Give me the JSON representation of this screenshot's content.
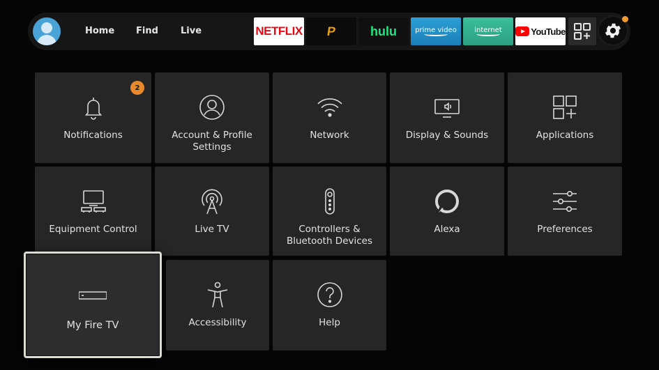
{
  "nav": {
    "home": "Home",
    "find": "Find",
    "live": "Live"
  },
  "apps": {
    "netflix": "NETFLIX",
    "plex": "P",
    "hulu": "hulu",
    "prime_video": "prime video",
    "internet": "internet",
    "youtube": "YouTube"
  },
  "icons": {
    "profile": "avatar-person-icon",
    "apps": "app-grid-icon",
    "settings": "gear-icon"
  },
  "colors": {
    "background": "#050505",
    "tile": "#262626",
    "badge": "#e88a2c",
    "focus_border": "#dcdcd4"
  },
  "settings_tiles": [
    {
      "label": "Notifications",
      "icon": "bell-icon",
      "badge": "2"
    },
    {
      "label": "Account & Profile Settings",
      "icon": "account-icon"
    },
    {
      "label": "Network",
      "icon": "wifi-icon"
    },
    {
      "label": "Display & Sounds",
      "icon": "display-sound-icon"
    },
    {
      "label": "Applications",
      "icon": "applications-icon"
    },
    {
      "label": "Equipment Control",
      "icon": "equipment-icon"
    },
    {
      "label": "Live TV",
      "icon": "antenna-icon"
    },
    {
      "label": "Controllers & Bluetooth Devices",
      "icon": "remote-icon"
    },
    {
      "label": "Alexa",
      "icon": "alexa-icon"
    },
    {
      "label": "Preferences",
      "icon": "sliders-icon"
    },
    {
      "label": "My Fire TV",
      "icon": "fire-tv-device-icon",
      "focused": true
    },
    {
      "label": "Accessibility",
      "icon": "accessibility-icon"
    },
    {
      "label": "Help",
      "icon": "help-icon"
    }
  ]
}
